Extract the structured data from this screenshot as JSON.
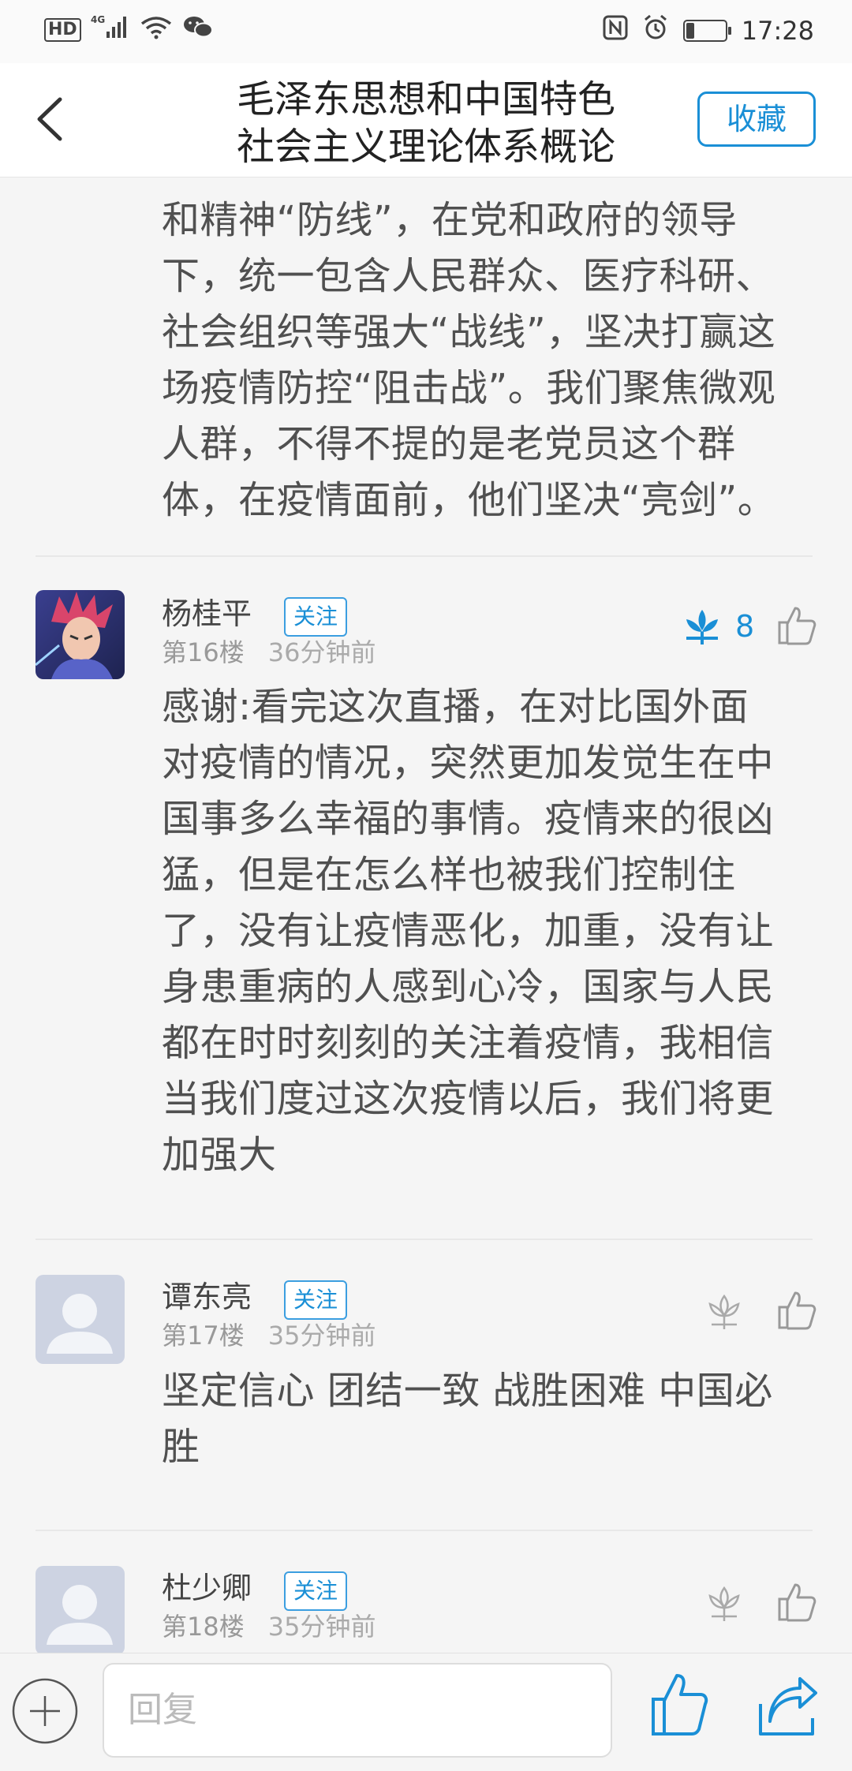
{
  "status_bar": {
    "hd": "HD",
    "network": "4G",
    "time": "17:28",
    "battery_level": 0.2
  },
  "header": {
    "title_line1": "毛泽东思想和中国特色",
    "title_line2": "社会主义理论体系概论",
    "favorite_label": "收藏"
  },
  "posts": [
    {
      "lines": [
        "和精神“防线”，在党和政府的领导",
        "下，统一包含人民群众、医疗科研、",
        "社会组织等强大“战线”，坚决打赢这",
        "场疫情防控“阻击战”。我们聚焦微观",
        "人群，不得不提的是老党员这个群",
        "体，在疫情面前，他们坚决“亮剑”。"
      ]
    },
    {
      "author": "杨桂平",
      "follow_label": "关注",
      "floor": "第16楼",
      "time": "36分钟前",
      "flower_count": "8",
      "flower_active": true,
      "lines": [
        "感谢:看完这次直播，在对比国外面",
        "对疫情的情况，突然更加发觉生在中",
        "国事多么幸福的事情。疫情来的很凶",
        "猛，但是在怎么样也被我们控制住",
        "了，没有让疫情恶化，加重，没有让",
        "身患重病的人感到心冷，国家与人民",
        "都在时时刻刻的关注着疫情，我相信",
        "当我们度过这次疫情以后，我们将更",
        "加强大"
      ]
    },
    {
      "author": "谭东亮",
      "follow_label": "关注",
      "floor": "第17楼",
      "time": "35分钟前",
      "flower_active": false,
      "lines": [
        "坚定信心 团结一致 战胜困难 中国必",
        "胜"
      ]
    },
    {
      "author": "杜少卿",
      "follow_label": "关注",
      "floor": "第18楼",
      "time": "35分钟前",
      "flower_active": false,
      "lines": []
    }
  ],
  "bottom_bar": {
    "reply_placeholder": "回复"
  },
  "colors": {
    "accent": "#1a8fd6",
    "text_body": "#505050",
    "meta_gray": "#aaaaaa"
  }
}
